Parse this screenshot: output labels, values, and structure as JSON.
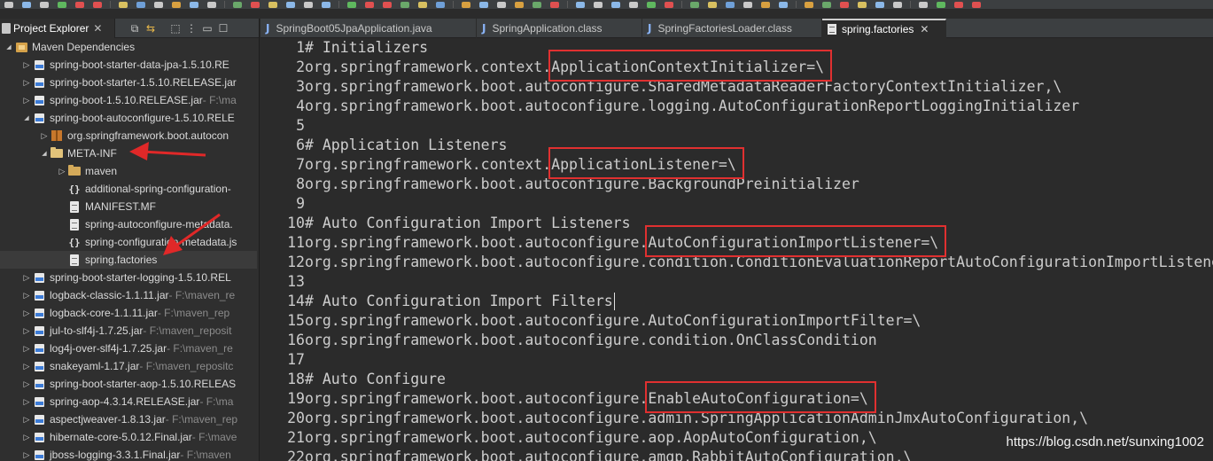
{
  "explorer": {
    "title": "Project Explorer",
    "close_glyph": "✕",
    "toolbar_icons": [
      "collapse-all-icon",
      "link-with-editor-icon",
      "focus-icon",
      "view-menu-icon",
      "minimize-icon",
      "maximize-icon"
    ],
    "tree": [
      {
        "depth": 0,
        "twisty": "expanded",
        "icon": "library-icon",
        "label": "Maven Dependencies",
        "path": ""
      },
      {
        "depth": 1,
        "twisty": "collapsed",
        "icon": "jar-icon",
        "label": "spring-boot-starter-data-jpa-1.5.10.RE",
        "path": ""
      },
      {
        "depth": 1,
        "twisty": "collapsed",
        "icon": "jar-icon",
        "label": "spring-boot-starter-1.5.10.RELEASE.jar",
        "path": ""
      },
      {
        "depth": 1,
        "twisty": "collapsed",
        "icon": "jar-icon",
        "label": "spring-boot-1.5.10.RELEASE.jar",
        "path": " - F:\\ma"
      },
      {
        "depth": 1,
        "twisty": "expanded",
        "icon": "jar-icon",
        "label": "spring-boot-autoconfigure-1.5.10.RELE",
        "path": ""
      },
      {
        "depth": 2,
        "twisty": "collapsed",
        "icon": "package-icon",
        "label": "org.springframework.boot.autocon",
        "path": ""
      },
      {
        "depth": 2,
        "twisty": "expanded",
        "icon": "folder-open-icon",
        "label": "META-INF",
        "path": ""
      },
      {
        "depth": 3,
        "twisty": "collapsed",
        "icon": "folder-icon",
        "label": "maven",
        "path": ""
      },
      {
        "depth": 3,
        "twisty": "none",
        "icon": "json-icon",
        "label": "additional-spring-configuration-",
        "path": ""
      },
      {
        "depth": 3,
        "twisty": "none",
        "icon": "file-icon",
        "label": "MANIFEST.MF",
        "path": ""
      },
      {
        "depth": 3,
        "twisty": "none",
        "icon": "file-icon",
        "label": "spring-autoconfigure-metadata.",
        "path": ""
      },
      {
        "depth": 3,
        "twisty": "none",
        "icon": "json-icon",
        "label": "spring-configuration-metadata.js",
        "path": ""
      },
      {
        "depth": 3,
        "twisty": "none",
        "icon": "file-icon",
        "label": "spring.factories",
        "path": "",
        "selected": true
      },
      {
        "depth": 1,
        "twisty": "collapsed",
        "icon": "jar-icon",
        "label": "spring-boot-starter-logging-1.5.10.REL",
        "path": ""
      },
      {
        "depth": 1,
        "twisty": "collapsed",
        "icon": "jar-icon",
        "label": "logback-classic-1.1.11.jar",
        "path": " - F:\\maven_re"
      },
      {
        "depth": 1,
        "twisty": "collapsed",
        "icon": "jar-icon",
        "label": "logback-core-1.1.11.jar",
        "path": " - F:\\maven_rep"
      },
      {
        "depth": 1,
        "twisty": "collapsed",
        "icon": "jar-icon",
        "label": "jul-to-slf4j-1.7.25.jar",
        "path": " - F:\\maven_reposit"
      },
      {
        "depth": 1,
        "twisty": "collapsed",
        "icon": "jar-icon",
        "label": "log4j-over-slf4j-1.7.25.jar",
        "path": " - F:\\maven_re"
      },
      {
        "depth": 1,
        "twisty": "collapsed",
        "icon": "jar-icon",
        "label": "snakeyaml-1.17.jar",
        "path": " - F:\\maven_repositc"
      },
      {
        "depth": 1,
        "twisty": "collapsed",
        "icon": "jar-icon",
        "label": "spring-boot-starter-aop-1.5.10.RELEAS",
        "path": ""
      },
      {
        "depth": 1,
        "twisty": "collapsed",
        "icon": "jar-icon",
        "label": "spring-aop-4.3.14.RELEASE.jar",
        "path": " - F:\\ma"
      },
      {
        "depth": 1,
        "twisty": "collapsed",
        "icon": "jar-icon",
        "label": "aspectjweaver-1.8.13.jar",
        "path": " - F:\\maven_rep"
      },
      {
        "depth": 1,
        "twisty": "collapsed",
        "icon": "jar-icon",
        "label": "hibernate-core-5.0.12.Final.jar",
        "path": " - F:\\mave"
      },
      {
        "depth": 1,
        "twisty": "collapsed",
        "icon": "jar-icon",
        "label": "jboss-logging-3.3.1.Final.jar",
        "path": " - F:\\maven"
      }
    ]
  },
  "editor_tabs": [
    {
      "label": "SpringBoot05JpaApplication.java",
      "icon": "java-file-icon",
      "active": false
    },
    {
      "label": "SpringApplication.class",
      "icon": "class-file-icon",
      "active": false
    },
    {
      "label": "SpringFactoriesLoader.class",
      "icon": "class-file-icon",
      "active": false
    },
    {
      "label": "spring.factories",
      "icon": "properties-file-icon",
      "active": true,
      "close": "✕"
    }
  ],
  "editor_lines": [
    {
      "num": "1",
      "text": "# Initializers"
    },
    {
      "num": "2",
      "text": "org.springframework.context.ApplicationContextInitializer=\\"
    },
    {
      "num": "3",
      "text": "org.springframework.boot.autoconfigure.SharedMetadataReaderFactoryContextInitializer,\\"
    },
    {
      "num": "4",
      "text": "org.springframework.boot.autoconfigure.logging.AutoConfigurationReportLoggingInitializer"
    },
    {
      "num": "5",
      "text": ""
    },
    {
      "num": "6",
      "text": "# Application Listeners"
    },
    {
      "num": "7",
      "text": "org.springframework.context.ApplicationListener=\\"
    },
    {
      "num": "8",
      "text": "org.springframework.boot.autoconfigure.BackgroundPreinitializer"
    },
    {
      "num": "9",
      "text": ""
    },
    {
      "num": "10",
      "text": "# Auto Configuration Import Listeners"
    },
    {
      "num": "11",
      "text": "org.springframework.boot.autoconfigure.AutoConfigurationImportListener=\\"
    },
    {
      "num": "12",
      "text": "org.springframework.boot.autoconfigure.condition.ConditionEvaluationReportAutoConfigurationImportListener"
    },
    {
      "num": "13",
      "text": ""
    },
    {
      "num": "14",
      "text": "# Auto Configuration Import Filters"
    },
    {
      "num": "15",
      "text": "org.springframework.boot.autoconfigure.AutoConfigurationImportFilter=\\"
    },
    {
      "num": "16",
      "text": "org.springframework.boot.autoconfigure.condition.OnClassCondition"
    },
    {
      "num": "17",
      "text": ""
    },
    {
      "num": "18",
      "text": "# Auto Configure"
    },
    {
      "num": "19",
      "text": "org.springframework.boot.autoconfigure.EnableAutoConfiguration=\\"
    },
    {
      "num": "20",
      "text": "org.springframework.boot.autoconfigure.admin.SpringApplicationAdminJmxAutoConfiguration,\\"
    },
    {
      "num": "21",
      "text": "org.springframework.boot.autoconfigure.aop.AopAutoConfiguration,\\"
    },
    {
      "num": "22",
      "text": "org.springframework.boot.autoconfigure.amqp.RabbitAutoConfiguration,\\"
    }
  ],
  "highlights": [
    "ApplicationContextInitializer=\\",
    "ApplicationListener=\\",
    "AutoConfigurationImportListener=\\",
    "EnableAutoConfiguration=\\"
  ],
  "watermark": "https://blog.csdn.net/sunxing1002",
  "colors": {
    "highlight_box": "#e03030",
    "editor_bg": "#2b2b2b",
    "panel_bg": "#2f2f2f"
  }
}
